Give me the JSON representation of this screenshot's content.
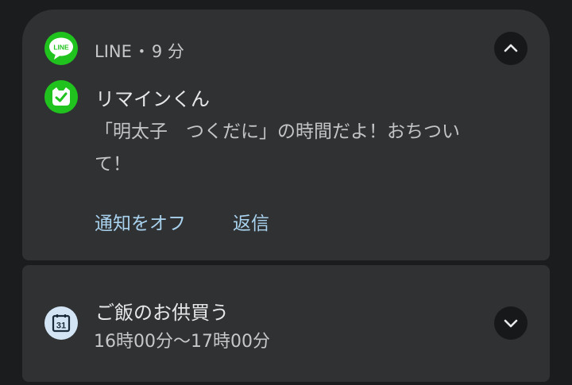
{
  "line_notification": {
    "app_name": "LINE",
    "separator": "・",
    "time_ago": "9 分",
    "app_icon_label": "LINE",
    "app_icon": "line-logo-icon",
    "avatar_icon": "check-badge-icon",
    "sender": "リマインくん",
    "message_line1": "「明太子　つくだに」の時間だよ！おちつい",
    "message_line2": "て！",
    "actions": [
      {
        "label": "通知をオフ"
      },
      {
        "label": "返信"
      }
    ],
    "collapse_icon": "chevron-up-icon"
  },
  "calendar_notification": {
    "icon": "calendar-icon",
    "icon_day": "31",
    "title": "ご飯のお供買う",
    "time_range": "16時00分～17時00分",
    "expand_icon": "chevron-down-icon"
  },
  "colors": {
    "background": "#1b1c1e",
    "card": "#2f3133",
    "line_green": "#20c31e",
    "action_text": "#a9d2ef",
    "calendar_icon_bg": "#d3e5f5"
  }
}
